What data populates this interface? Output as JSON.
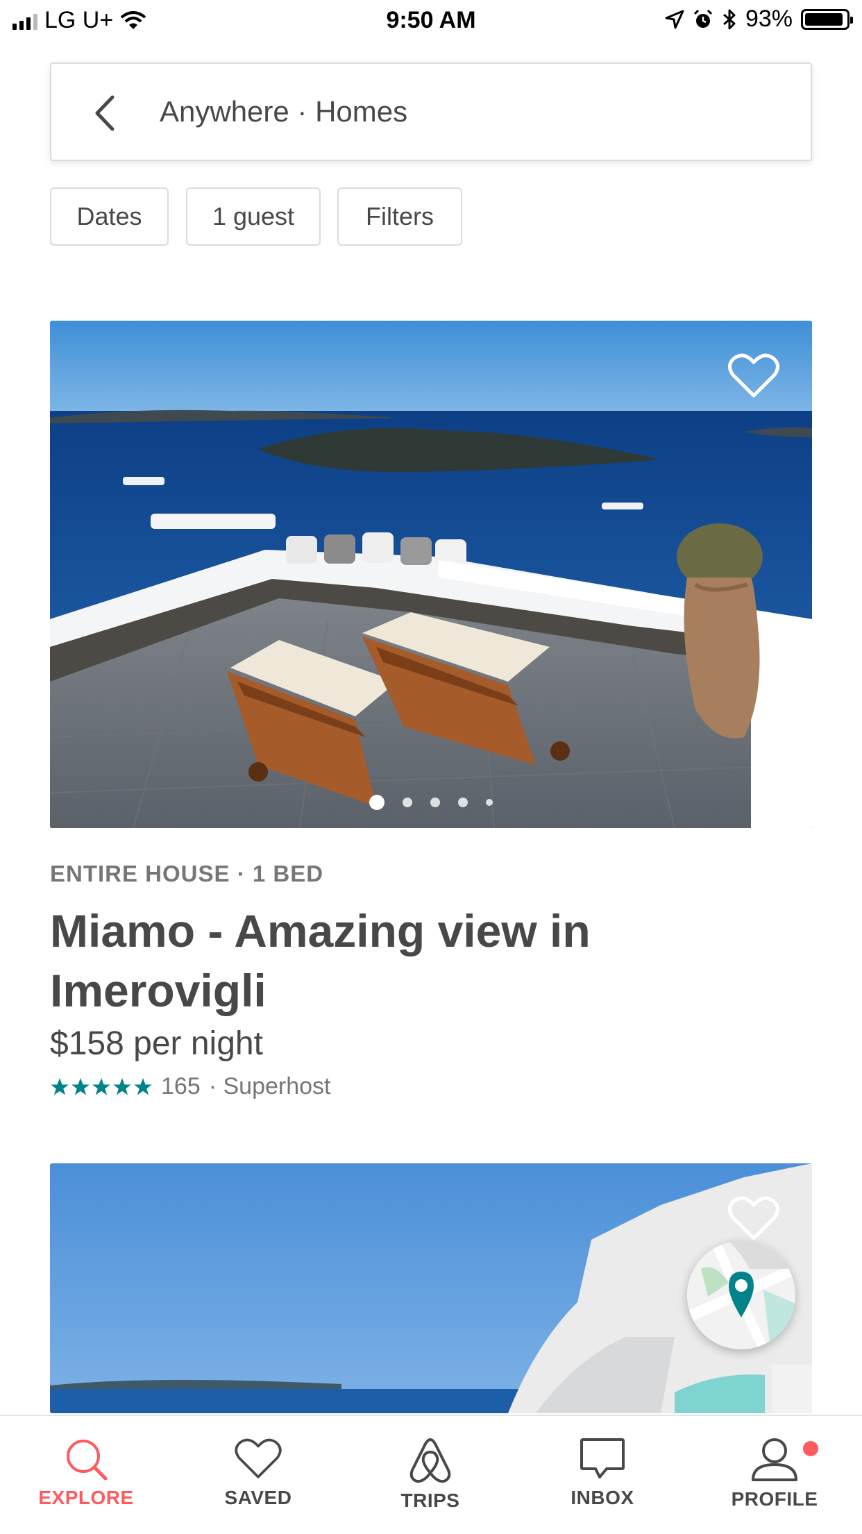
{
  "status_bar": {
    "carrier": "LG U+",
    "time": "9:50 AM",
    "battery_percent": "93%",
    "battery_level": 0.93,
    "icons": [
      "signal-icon",
      "wifi-icon",
      "location-icon",
      "alarm-icon",
      "bluetooth-icon",
      "battery-icon"
    ]
  },
  "search": {
    "text": "Anywhere · Homes",
    "back_icon": "chevron-left-icon"
  },
  "filters": [
    {
      "label": "Dates"
    },
    {
      "label": "1 guest"
    },
    {
      "label": "Filters"
    }
  ],
  "listings": [
    {
      "kicker": "ENTIRE HOUSE · 1 BED",
      "title": "Miamo - Amazing view in Imerovigli",
      "price": "$158 per night",
      "stars": 5,
      "review_count": "165",
      "badge": "· Superhost",
      "photo_count_dots": 5,
      "active_photo": 1
    },
    {
      "photo_only": true
    }
  ],
  "colors": {
    "accent": "#FF5A5F",
    "teal": "#008489",
    "text": "#484848",
    "muted": "#767676"
  },
  "nav": {
    "items": [
      {
        "label": "EXPLORE",
        "icon": "search-icon",
        "active": true
      },
      {
        "label": "SAVED",
        "icon": "heart-icon",
        "active": false
      },
      {
        "label": "TRIPS",
        "icon": "airbnb-logo-icon",
        "active": false
      },
      {
        "label": "INBOX",
        "icon": "chat-icon",
        "active": false
      },
      {
        "label": "PROFILE",
        "icon": "user-icon",
        "active": false,
        "notification": true
      }
    ]
  }
}
